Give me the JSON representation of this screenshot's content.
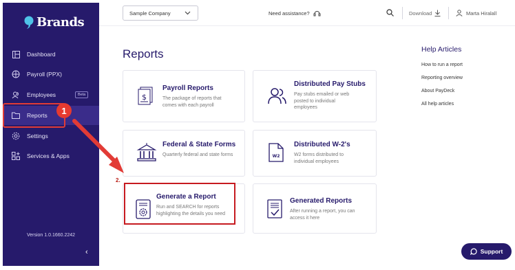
{
  "brand": {
    "logo_text": "Brands"
  },
  "sidebar": {
    "items": [
      {
        "label": "Dashboard",
        "icon": "dashboard-icon"
      },
      {
        "label": "Payroll (PPX)",
        "icon": "payroll-icon"
      },
      {
        "label": "Employees",
        "icon": "employees-icon",
        "badge": "Beta"
      },
      {
        "label": "Reports",
        "icon": "folder-icon",
        "active": true
      },
      {
        "label": "Settings",
        "icon": "gear-icon"
      },
      {
        "label": "Services & Apps",
        "icon": "apps-icon"
      }
    ],
    "version": "Version 1.0.1660.2242",
    "collapse_glyph": "‹"
  },
  "header": {
    "company_select": "Sample Company",
    "assistance": "Need assistance?",
    "download": "Download",
    "user_name": "Marta Hiralall"
  },
  "main": {
    "title": "Reports",
    "cards": [
      {
        "title": "Payroll Reports",
        "desc": "The package of reports that comes with each payroll",
        "icon": "payroll-reports-icon"
      },
      {
        "title": "Distributed Pay Stubs",
        "desc": "Pay stubs emailed or web posted to individual employees",
        "icon": "people-icon"
      },
      {
        "title": "Federal & State Forms",
        "desc": "Quarterly federal and state forms",
        "icon": "government-building-icon"
      },
      {
        "title": "Distributed W-2's",
        "desc": "W2 forms distributed to individual employees",
        "icon": "w2-document-icon",
        "icon_text": "W2"
      },
      {
        "title": "Generate a Report",
        "desc": "Run and SEARCH for reports highlighting the details you need",
        "icon": "report-gear-icon"
      },
      {
        "title": "Generated Reports",
        "desc": "After running a report, you can access it here",
        "icon": "report-check-icon"
      }
    ]
  },
  "help": {
    "title": "Help Articles",
    "links": [
      "How to run a report",
      "Reporting overview",
      "About PayDeck",
      "All help articles"
    ]
  },
  "annotations": {
    "step1": "1",
    "step2": "2."
  },
  "support": {
    "label": "Support"
  },
  "colors": {
    "sidebar": "#261a6b",
    "accent": "#261a6b",
    "annotation": "#e23b36"
  }
}
